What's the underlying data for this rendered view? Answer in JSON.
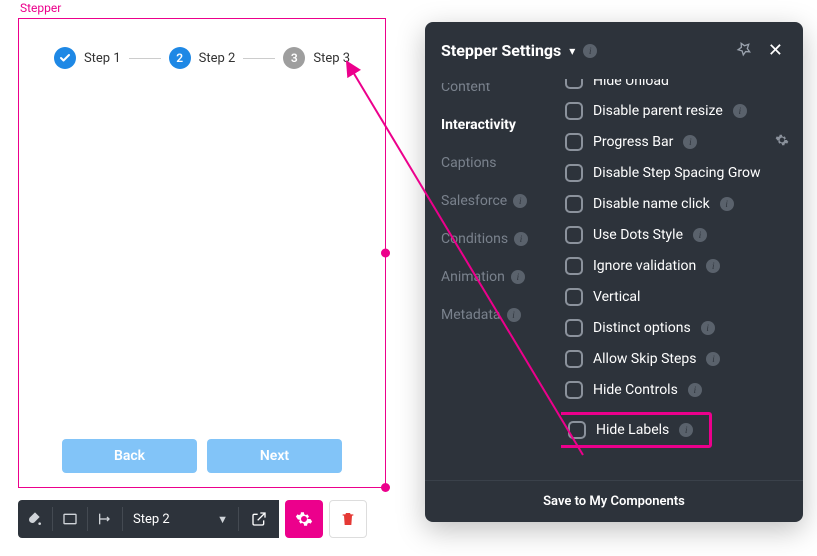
{
  "canvas": {
    "tag": "Stepper",
    "steps": [
      {
        "label": "Step 1",
        "state": "done"
      },
      {
        "label": "Step 2",
        "state": "active",
        "num": "2"
      },
      {
        "label": "Step 3",
        "state": "upcoming",
        "num": "3"
      }
    ],
    "back_label": "Back",
    "next_label": "Next"
  },
  "toolbar": {
    "selected_step": "Step 2"
  },
  "panel": {
    "title": "Stepper Settings",
    "tabs": {
      "clipped": "Content",
      "interactivity": "Interactivity",
      "captions": "Captions",
      "salesforce": "Salesforce",
      "conditions": "Conditions",
      "animation": "Animation",
      "metadata": "Metadata"
    },
    "options": {
      "clipped": "Hide Unload",
      "disable_parent_resize": "Disable parent resize",
      "progress_bar": "Progress Bar",
      "disable_step_spacing_grow": "Disable Step Spacing Grow",
      "disable_name_click": "Disable name click",
      "use_dots_style": "Use Dots Style",
      "ignore_validation": "Ignore validation",
      "vertical": "Vertical",
      "distinct_options": "Distinct options",
      "allow_skip_steps": "Allow Skip Steps",
      "hide_controls": "Hide Controls",
      "hide_labels": "Hide Labels"
    },
    "footer": "Save to My Components"
  }
}
